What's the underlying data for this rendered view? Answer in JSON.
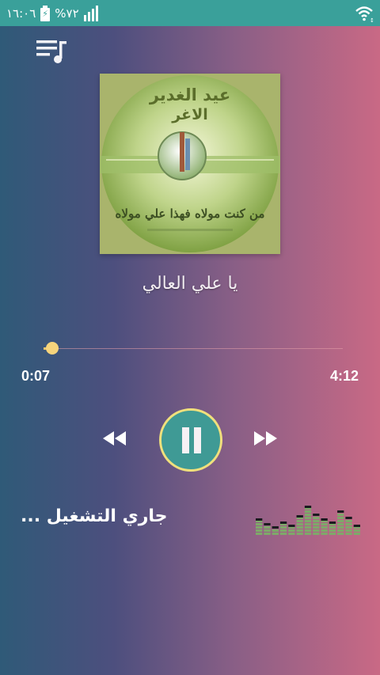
{
  "status_bar": {
    "time": "١٦:٠٦",
    "battery_percent": "%٧٢",
    "background_color": "#3aa09a",
    "icons": [
      "battery-charging-icon",
      "signal-icon",
      "wifi-icon"
    ]
  },
  "toolbar": {
    "playlist_icon": "queue-music-icon"
  },
  "album_art": {
    "line1": "عيد الغدير",
    "line2": "الاغر",
    "calligraphy": "من كنت مولاه فهذا علي مولاه"
  },
  "track": {
    "title": "يا علي العالي"
  },
  "player": {
    "current_time": "0:07",
    "total_time": "4:12",
    "progress_fraction": 0.028,
    "accent_color": "#f6d47c",
    "play_button_color": "#3f9a95",
    "controls": [
      "rewind-icon",
      "pause-icon",
      "fast-forward-icon"
    ]
  },
  "now_playing": {
    "label": "جاري التشغيل ..."
  },
  "visualizer": {
    "levels": [
      0.45,
      0.3,
      0.2,
      0.35,
      0.25,
      0.55,
      0.85,
      0.6,
      0.45,
      0.35,
      0.7,
      0.5,
      0.25
    ]
  }
}
